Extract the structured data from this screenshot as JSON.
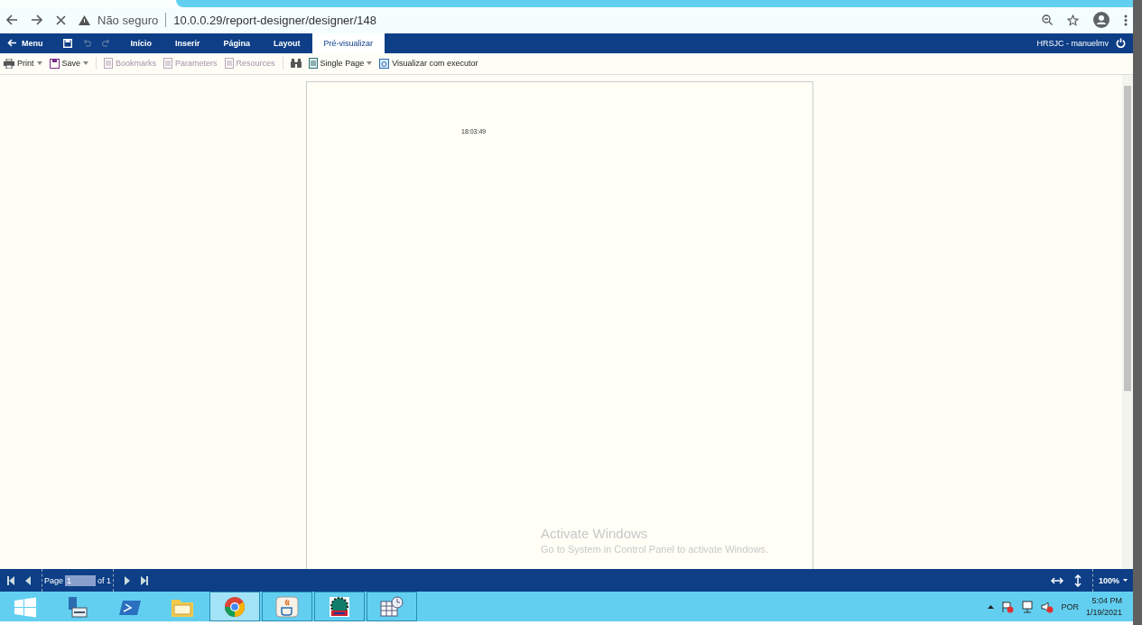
{
  "browser": {
    "security": "Não seguro",
    "url": "10.0.0.29/report-designer/designer/148"
  },
  "menubar": {
    "menu": "Menu",
    "tabs": [
      {
        "label": "Início",
        "selected": false
      },
      {
        "label": "Inserir",
        "selected": false
      },
      {
        "label": "Página",
        "selected": false
      },
      {
        "label": "Layout",
        "selected": false
      },
      {
        "label": "Pré-visualizar",
        "selected": true
      }
    ],
    "user": "HRSJC - manuelmv"
  },
  "toolbar": [
    {
      "kind": "print",
      "label": "Print",
      "dropdown": true,
      "disabled": false
    },
    {
      "kind": "save",
      "label": "Save",
      "dropdown": true,
      "disabled": false
    },
    {
      "kind": "separator"
    },
    {
      "kind": "bookmarks",
      "label": "Bookmarks",
      "dropdown": false,
      "disabled": true
    },
    {
      "kind": "parameters",
      "label": "Parameters",
      "dropdown": false,
      "disabled": true
    },
    {
      "kind": "resources",
      "label": "Resources",
      "dropdown": false,
      "disabled": true
    },
    {
      "kind": "separator"
    },
    {
      "kind": "find",
      "dropdown": false,
      "disabled": false
    },
    {
      "kind": "single-page",
      "label": "Single Page",
      "dropdown": true,
      "disabled": false
    },
    {
      "kind": "run",
      "label": "Visualizar com executor",
      "dropdown": false,
      "disabled": false
    }
  ],
  "report": {
    "time": "18:03:49"
  },
  "notice": {
    "title": "Activate Windows",
    "subtitle": "Go to System in Control Panel to activate Windows."
  },
  "pager": {
    "label": "Page",
    "value": "1",
    "of": "of 1",
    "zoom": "100%"
  },
  "taskbar": {
    "apps": [
      {
        "kind": "start",
        "open": false,
        "selected": false
      },
      {
        "kind": "server",
        "open": false,
        "selected": false
      },
      {
        "kind": "powershell",
        "open": false,
        "selected": false
      },
      {
        "kind": "folder",
        "open": false,
        "selected": false
      },
      {
        "kind": "chrome",
        "open": true,
        "selected": true
      },
      {
        "kind": "java",
        "open": true,
        "selected": false
      },
      {
        "kind": "gear",
        "open": true,
        "selected": false
      },
      {
        "kind": "calendar",
        "open": true,
        "selected": false
      }
    ],
    "language": "POR",
    "time": "5:04 PM",
    "date": "1/19/2021"
  }
}
